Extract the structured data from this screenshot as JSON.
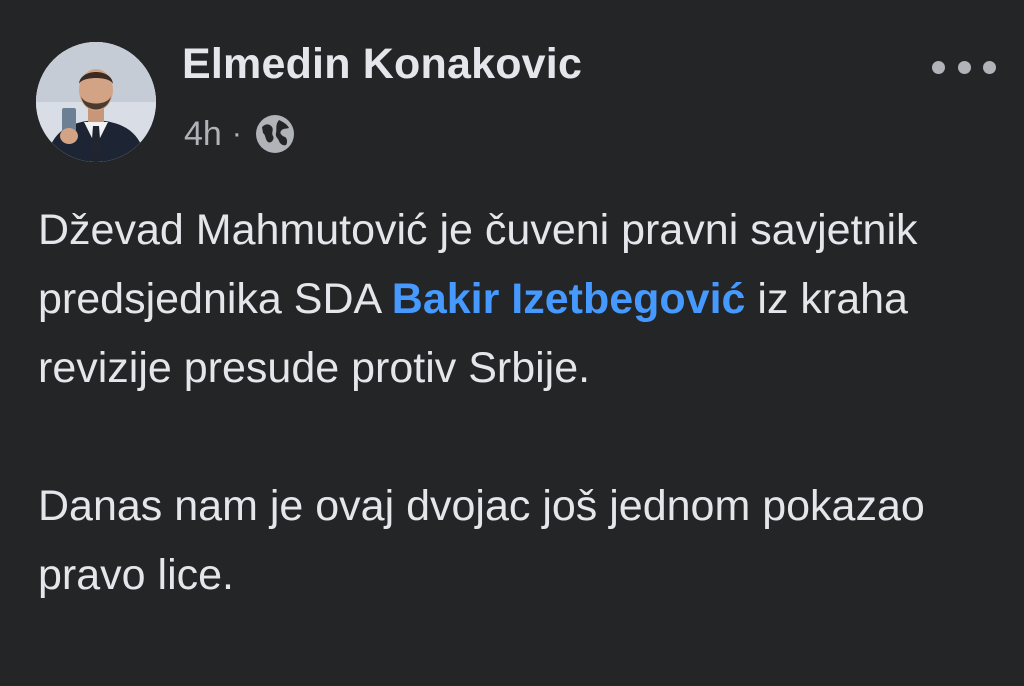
{
  "post": {
    "author": {
      "name": "Elmedin Konakovic",
      "avatar_icon": "profile-photo"
    },
    "timestamp": "4h",
    "separator": "·",
    "audience_icon": "globe-icon",
    "more_icon": "more-options-icon",
    "paragraph1": {
      "text_before": "Dževad Mahmutović je čuveni pravni savjetnik predsjednika SDA ",
      "mention": "Bakir Izetbegović",
      "text_after": " iz kraha revizije presude protiv Srbije."
    },
    "paragraph2": "Danas nam je ovaj dvojac još jednom pokazao pravo lice."
  },
  "colors": {
    "background": "#242526",
    "text_primary": "#e4e6eb",
    "text_secondary": "#b0b3b8",
    "link": "#4599ff"
  }
}
